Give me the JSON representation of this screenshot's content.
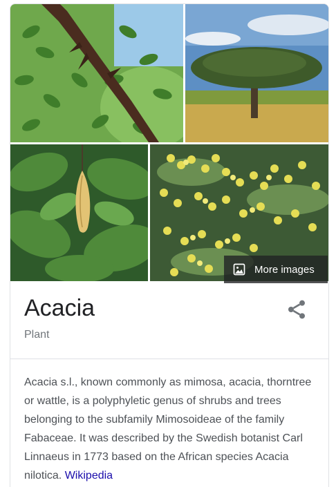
{
  "knowledge_panel": {
    "images": [
      {
        "subject": "acacia thorny branch with leaflets"
      },
      {
        "subject": "umbrella acacia tree in savanna"
      },
      {
        "subject": "acacia seed pod among leaves"
      },
      {
        "subject": "yellow mimosa flowers"
      }
    ],
    "more_images_label": "More images",
    "title": "Acacia",
    "subtitle": "Plant",
    "description_text": "Acacia s.l., known commonly as mimosa, acacia, thorntree or wattle, is a polyphyletic genus of shrubs and trees belonging to the subfamily Mimosoideae of the family Fabaceae. It was described by the Swedish botanist Carl Linnaeus in 1773 based on the African species Acacia nilotica.",
    "source_link": "Wikipedia",
    "share_icon": "share-icon",
    "colors": {
      "title": "#202124",
      "subtitle": "#70757a",
      "body": "#4d5156",
      "link": "#1a0dab",
      "border": "#dfe1e5"
    }
  }
}
